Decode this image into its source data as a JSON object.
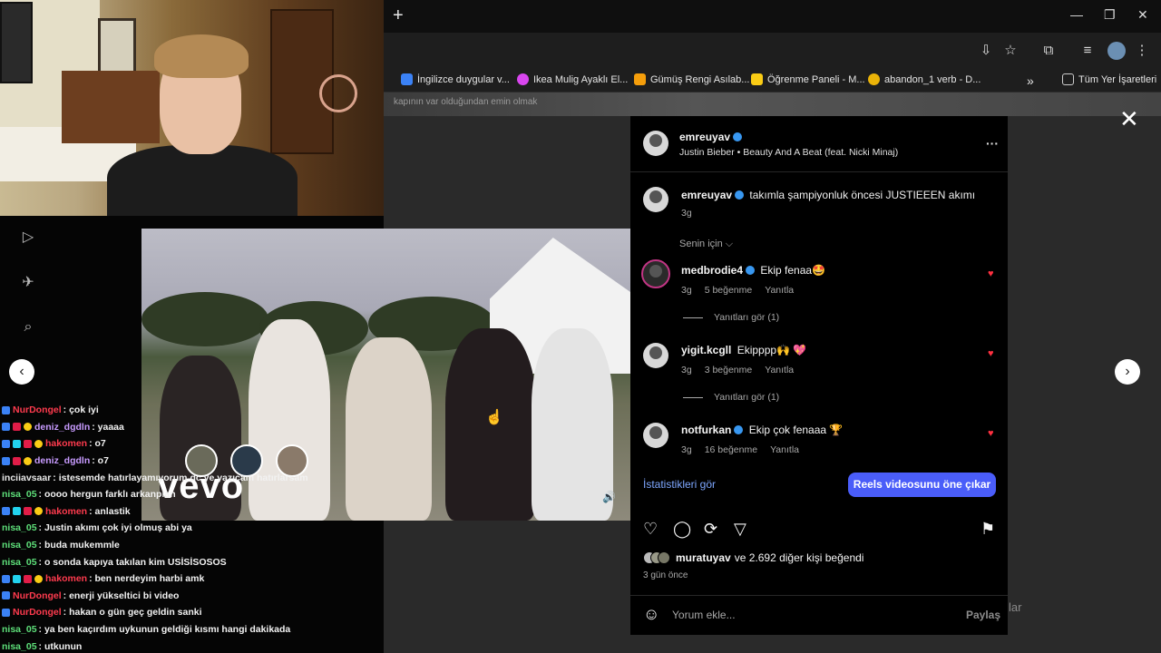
{
  "browser": {
    "new_tab": "+",
    "window_controls": [
      "—",
      "❐",
      "✕"
    ],
    "bookmarks": [
      {
        "label": "İngilizce duygular v...",
        "color": "#3b82f6"
      },
      {
        "label": "Ikea Mulig Ayaklı El...",
        "color": "#d946ef"
      },
      {
        "label": "Gümüş Rengi Asılab...",
        "color": "#f59e0b"
      },
      {
        "label": "Öğrenme Paneli - M...",
        "color": "#facc15"
      },
      {
        "label": "abandon_1 verb - D...",
        "color": "#eab308"
      }
    ],
    "more_bookmarks": "»",
    "all_bookmarks": "Tüm Yer İşaretleri"
  },
  "page": {
    "bg_caption": "kapının var olduğundan emin olmak",
    "close": "✕",
    "prev": "‹",
    "next": "›",
    "dim_text": "lar"
  },
  "chat": [
    {
      "nick": "NurDongel",
      "color": "red",
      "badges": [
        "blue"
      ],
      "msg": ": çok iyi"
    },
    {
      "nick": "deniz_dgdln",
      "color": "purple",
      "badges": [
        "blue",
        "red",
        "yel"
      ],
      "msg": ": yaaaa"
    },
    {
      "nick": "hakomen",
      "color": "red",
      "badges": [
        "blue",
        "cyan",
        "red",
        "yel"
      ],
      "msg": ": o7"
    },
    {
      "nick": "deniz_dgdln",
      "color": "purple",
      "badges": [
        "blue",
        "red",
        "yel"
      ],
      "msg": ": o7"
    },
    {
      "nick": "inciiavsaar",
      "color": "white",
      "badges": [],
      "msg": ": istesemde hatırlayamıyorum dc ye yazıcam hatırlarsam"
    },
    {
      "nick": "nisa_05",
      "color": "green",
      "badges": [],
      "msg": ": oooo hergun farklı arkanplan"
    },
    {
      "nick": "hakomen",
      "color": "red",
      "badges": [
        "blue",
        "cyan",
        "red",
        "yel"
      ],
      "msg": ": anlastik"
    },
    {
      "nick": "nisa_05",
      "color": "green",
      "badges": [],
      "msg": ": Justin akımı çok iyi olmuş abi ya"
    },
    {
      "nick": "nisa_05",
      "color": "green",
      "badges": [],
      "msg": ": buda mukemmle"
    },
    {
      "nick": "nisa_05",
      "color": "green",
      "badges": [],
      "msg": ": o sonda kapıya takılan kim USİSİSOSOS"
    },
    {
      "nick": "hakomen",
      "color": "red",
      "badges": [
        "blue",
        "cyan",
        "red",
        "yel"
      ],
      "msg": ": ben nerdeyim harbi amk"
    },
    {
      "nick": "NurDongel",
      "color": "red",
      "badges": [
        "blue"
      ],
      "msg": ": enerji yükseltici bi video"
    },
    {
      "nick": "NurDongel",
      "color": "red",
      "badges": [
        "blue"
      ],
      "msg": ": hakan o gün geç geldin sanki"
    },
    {
      "nick": "nisa_05",
      "color": "green",
      "badges": [],
      "msg": ": ya ben kaçırdım uykunun geldiği kısmı hangi dakikada"
    },
    {
      "nick": "nisa_05",
      "color": "green",
      "badges": [],
      "msg": ": utkunun"
    }
  ],
  "video": {
    "brand": "vevo",
    "mute_icon": "🔊"
  },
  "post": {
    "username": "emreuyav",
    "audio": "Justin Bieber • Beauty And A Beat (feat. Nicki Minaj)",
    "more": "···",
    "caption_user": "emreuyav",
    "caption": "takımla şampiyonluk öncesi JUSTIEEEN akımı",
    "caption_time": "3g",
    "filter": "Senin için ⌵",
    "comments": [
      {
        "user": "medbrodie4",
        "text": "Ekip fenaa🤩",
        "time": "3g",
        "likes": "5 beğenme",
        "reply": "Yanıtla",
        "view_replies": "Yanıtları gör (1)"
      },
      {
        "user": "yigit.kcgll",
        "text": "Ekipppp🙌 💖",
        "time": "3g",
        "likes": "3 beğenme",
        "reply": "Yanıtla",
        "view_replies": "Yanıtları gör (1)"
      },
      {
        "user": "notfurkan",
        "text": "Ekip çok fenaaa 🏆",
        "time": "3g",
        "likes": "16 beğenme",
        "reply": "Yanıtla",
        "view_replies": ""
      }
    ],
    "stats_link": "İstatistikleri gör",
    "promote": "Reels videosunu öne çıkar",
    "liked_by_user": "muratuyav",
    "liked_by_rest": "ve 2.692 diğer kişi beğendi",
    "posted": "3 gün önce",
    "comment_placeholder": "Yorum ekle...",
    "share": "Paylaş"
  }
}
